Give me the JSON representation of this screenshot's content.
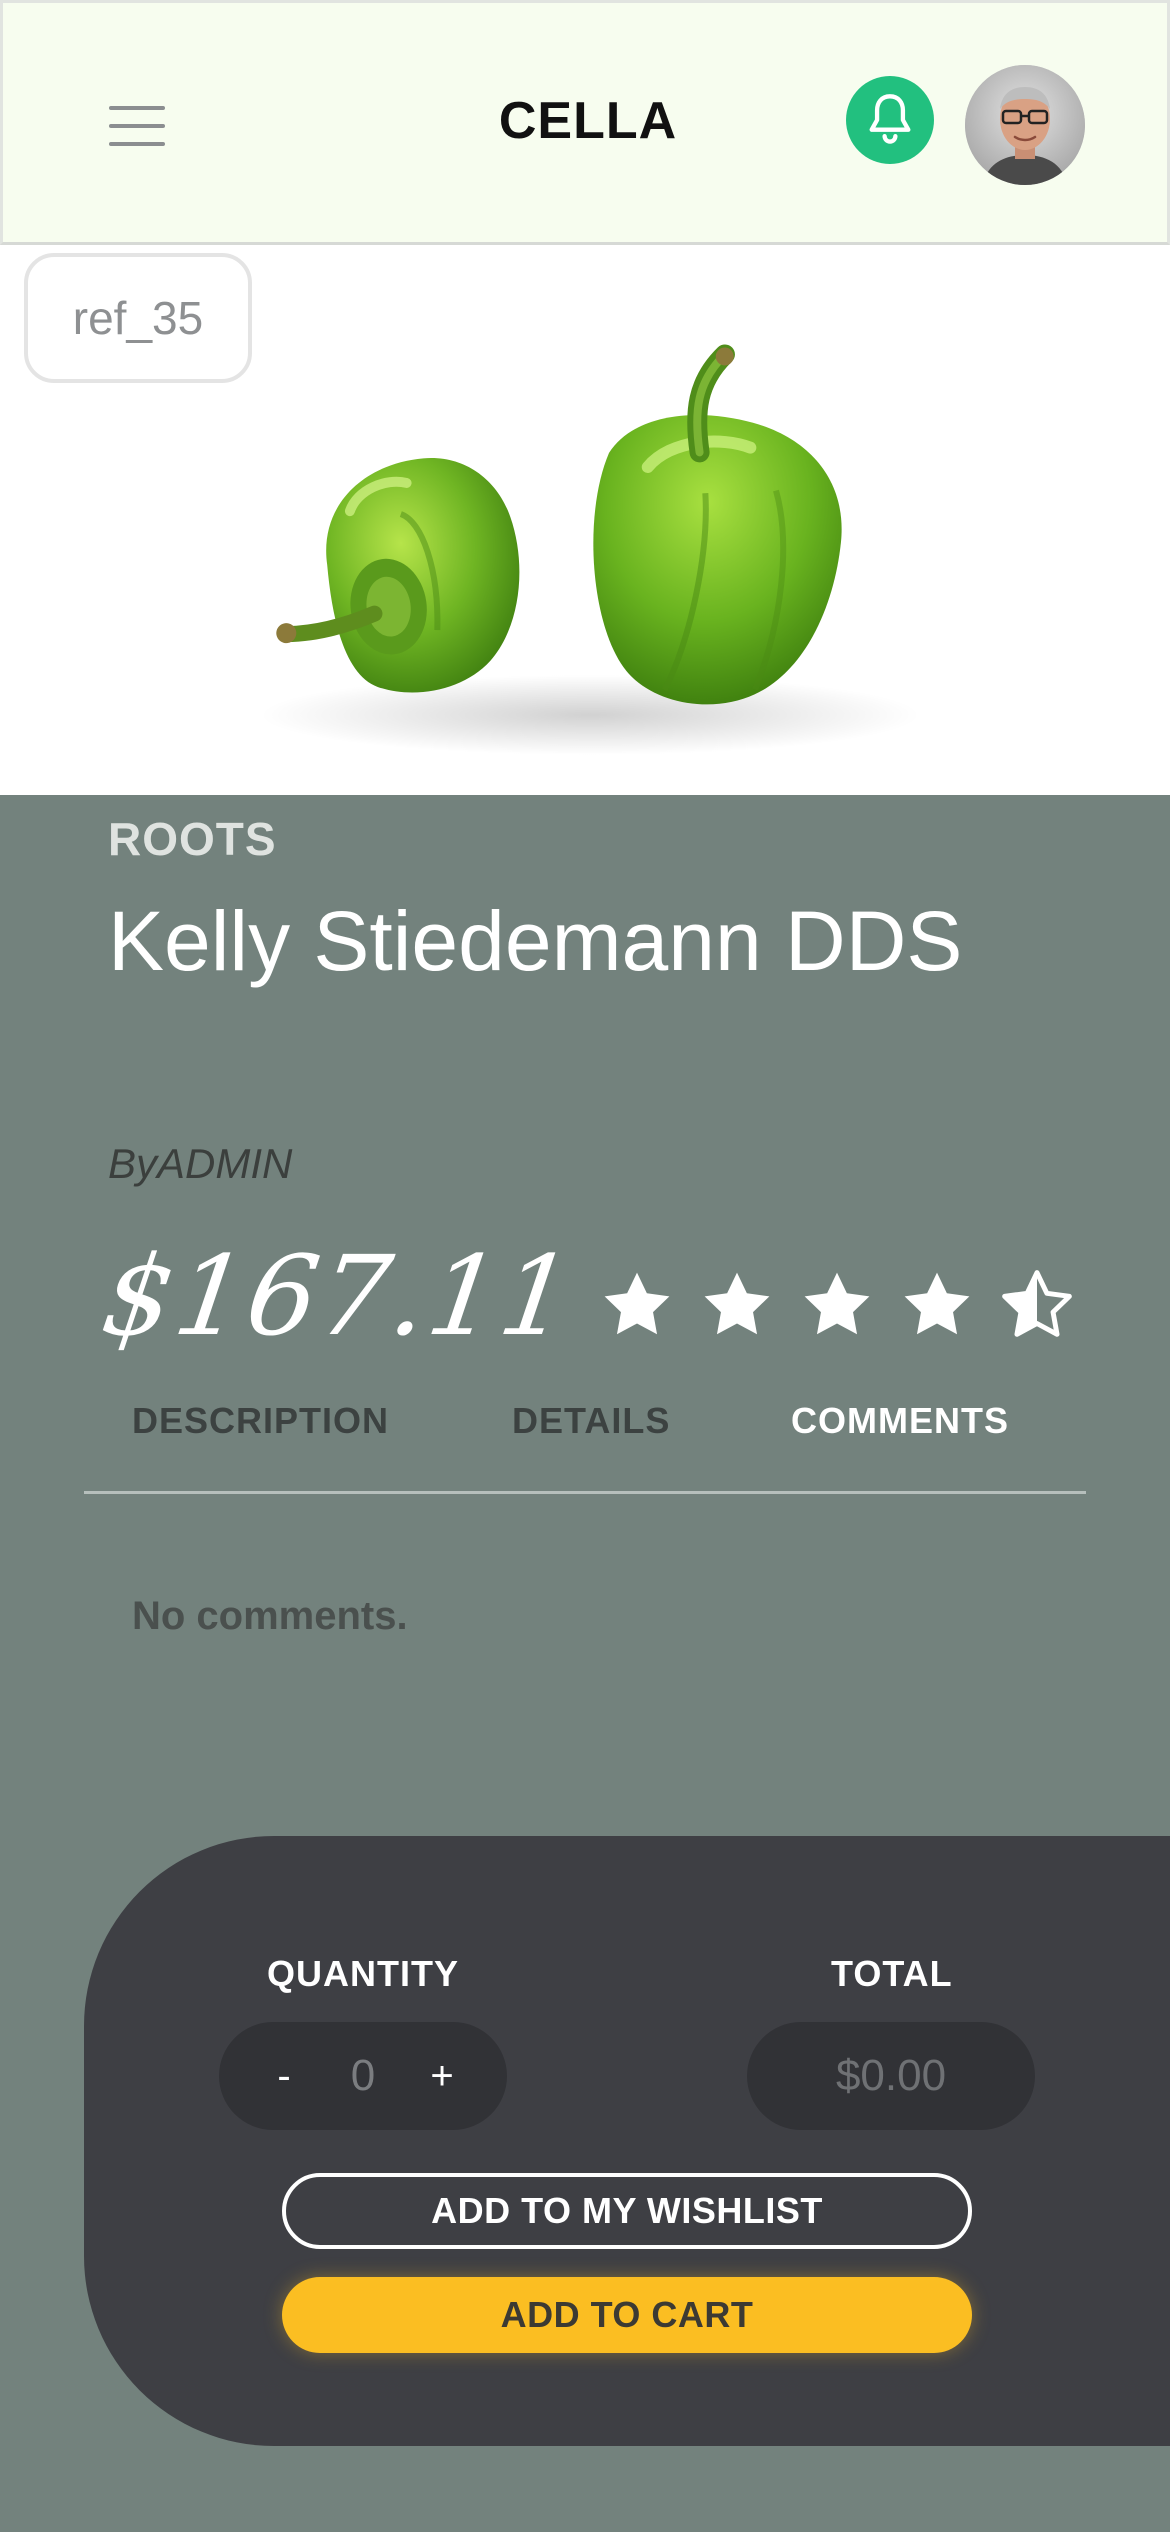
{
  "header": {
    "brand": "CELLA",
    "menu_icon": "hamburger-menu-icon",
    "notification_icon": "bell-icon",
    "avatar": "user-avatar",
    "colors": {
      "background": "#f7fdef",
      "bell": "#22c07f"
    }
  },
  "product": {
    "ref": "ref_35",
    "image": "green-bell-peppers",
    "category": "ROOTS",
    "title": "Kelly Stiedemann DDS",
    "byline_prefix": "By",
    "byline_author": "ADMIN",
    "price": "$167.11",
    "rating": 4.5,
    "rating_max": 5
  },
  "tabs": {
    "description": "DESCRIPTION",
    "details": "DETAILS",
    "comments": "COMMENTS",
    "active": "comments"
  },
  "comments": {
    "empty_text": "No comments."
  },
  "purchase": {
    "quantity_label": "QUANTITY",
    "total_label": "TOTAL",
    "decrement": "-",
    "increment": "+",
    "quantity_value": "0",
    "total_value": "$0.00",
    "wishlist_label": "ADD TO MY WISHLIST",
    "cart_label": "ADD TO CART",
    "colors": {
      "panel": "#3e3f44",
      "cart_button": "#fbbe22",
      "page": "#73827d"
    }
  }
}
